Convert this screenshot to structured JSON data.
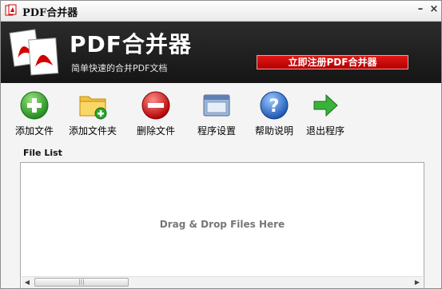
{
  "window": {
    "title": "PDF合并器"
  },
  "banner": {
    "app_name": "PDF合并器",
    "tagline": "简单快速的合并PDF文档",
    "register_label": "立即注册PDF合并器"
  },
  "toolbar": {
    "items": [
      {
        "label": "添加文件",
        "icon": "add-icon"
      },
      {
        "label": "添加文件夹",
        "icon": "folder-add-icon"
      },
      {
        "label": "删除文件",
        "icon": "remove-icon"
      },
      {
        "label": "程序设置",
        "icon": "settings-window-icon"
      },
      {
        "label": "帮助说明",
        "icon": "help-icon"
      },
      {
        "label": "退出程序",
        "icon": "exit-arrow-icon"
      }
    ]
  },
  "file_list": {
    "title": "File List",
    "drop_hint": "Drag & Drop Files Here"
  },
  "colors": {
    "banner": "#1e1e1e",
    "register": "#c80000",
    "add": "#2aa52a",
    "remove": "#d41616",
    "help": "#1e6fd0"
  }
}
